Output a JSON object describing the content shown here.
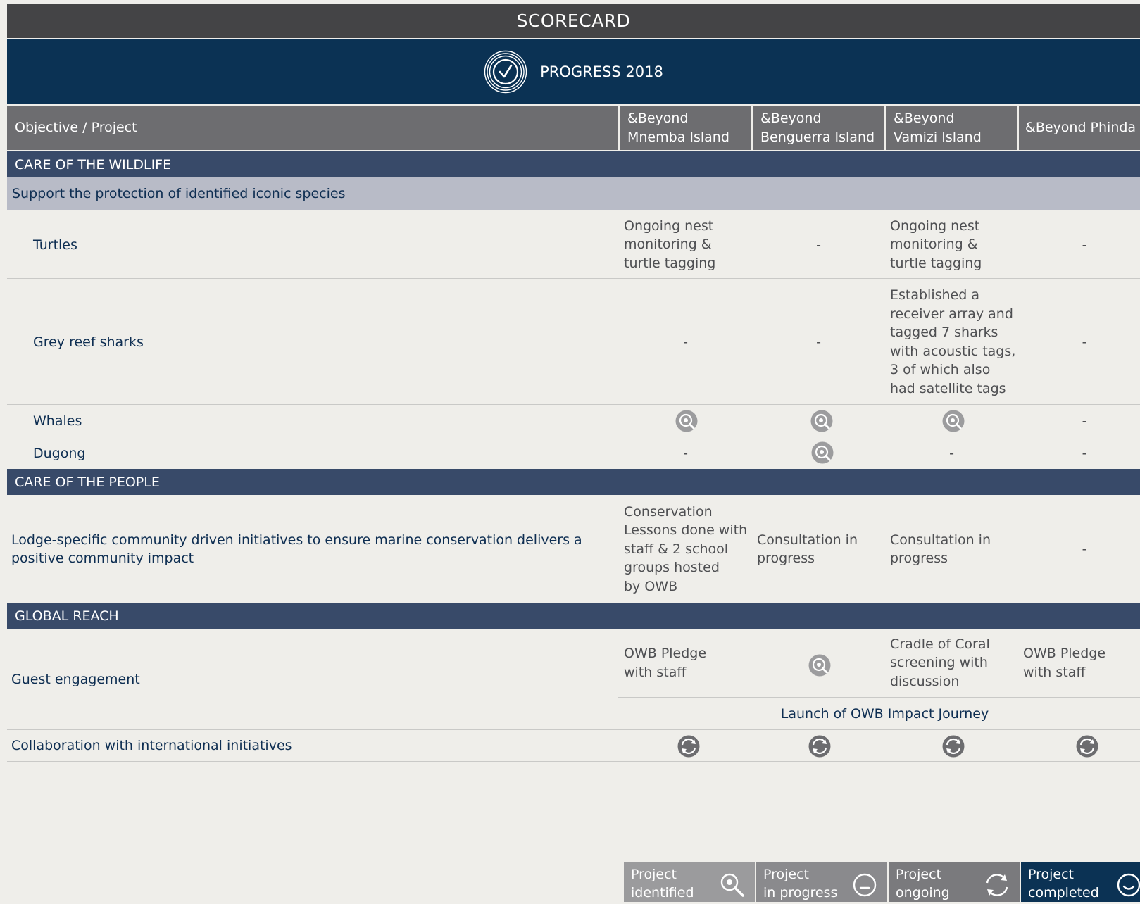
{
  "title": "SCORECARD",
  "subtitle": "PROGRESS 2018",
  "header": {
    "objective": "Objective / Project",
    "col1": [
      "&Beyond",
      "Mnemba Island"
    ],
    "col2": [
      "&Beyond",
      "Benguerra Island"
    ],
    "col3": [
      "&Beyond",
      "Vamizi Island"
    ],
    "col4": "&Beyond Phinda"
  },
  "sections": {
    "wildlife": "CARE OF THE WILDLIFE",
    "people": "CARE OF THE PEOPLE",
    "global": "GLOBAL REACH"
  },
  "subsection_wildlife": "Support the protection of identified iconic species",
  "dash": "-",
  "rows": {
    "turtles": {
      "label": "Turtles",
      "mnemba": [
        "Ongoing nest",
        "monitoring &",
        "turtle tagging"
      ],
      "vamizi": [
        "Ongoing nest",
        "monitoring &",
        "turtle tagging"
      ]
    },
    "sharks": {
      "label": "Grey reef sharks",
      "vamizi": [
        "Established a",
        "receiver array and",
        "tagged 7 sharks",
        "with acoustic tags,",
        "3 of which also",
        "had satellite tags"
      ]
    },
    "whales": {
      "label": "Whales",
      "status": [
        "identified",
        "identified",
        "identified",
        "none"
      ]
    },
    "dugong": {
      "label": "Dugong",
      "status": [
        "none",
        "identified",
        "none",
        "none"
      ]
    },
    "community": {
      "label": [
        "Lodge-specific community driven initiatives to ensure marine conservation delivers a",
        "positive community impact"
      ],
      "mnemba": [
        "Conservation",
        "Lessons done with",
        "staff & 2 school",
        "groups hosted",
        "by OWB"
      ],
      "benguerra": [
        "Consultation in",
        "progress"
      ],
      "vamizi": [
        "Consultation in",
        "progress"
      ]
    },
    "guest": {
      "label": "Guest engagement",
      "mnemba": [
        "OWB Pledge",
        "with staff"
      ],
      "vamizi": [
        "Cradle of Coral",
        "screening with",
        "discussion"
      ],
      "phinda": [
        "OWB Pledge",
        "with staff"
      ],
      "shared": "Launch of OWB Impact Journey"
    },
    "collab": {
      "label": "Collaboration with international initiatives",
      "status": [
        "ongoing",
        "ongoing",
        "ongoing",
        "ongoing"
      ]
    }
  },
  "legend": [
    {
      "lines": [
        "Project",
        "identified"
      ],
      "icon": "magnifier-icon",
      "color": "#9b9b9d"
    },
    {
      "lines": [
        "Project",
        "in progress"
      ],
      "icon": "progress-circle-icon",
      "color": "#8a8a8d"
    },
    {
      "lines": [
        "Project",
        "ongoing"
      ],
      "icon": "cycle-arrows-icon",
      "color": "#7a7a7d"
    },
    {
      "lines": [
        "Project",
        "completed"
      ],
      "icon": "smile-circle-icon",
      "color": "#0b3254"
    }
  ]
}
